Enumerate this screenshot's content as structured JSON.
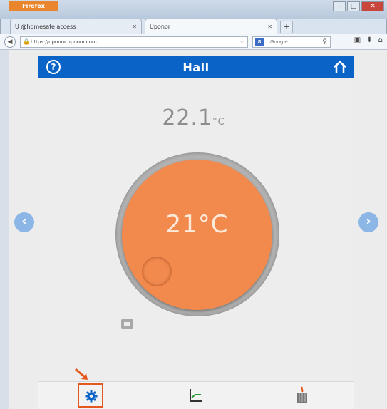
{
  "browser": {
    "menu_button": "Firefox",
    "tabs": [
      {
        "label": "U @homesafe access"
      },
      {
        "label": "Uponor"
      }
    ],
    "address": "https://uponor.uponor.com",
    "search_placeholder": "Google",
    "new_tab": "+"
  },
  "app": {
    "title": "Hall",
    "current_temp": "22.1",
    "current_temp_unit": "°C",
    "set_temp": "21°C",
    "accent": "#0a64c8",
    "dial_color": "#f28a4e"
  }
}
